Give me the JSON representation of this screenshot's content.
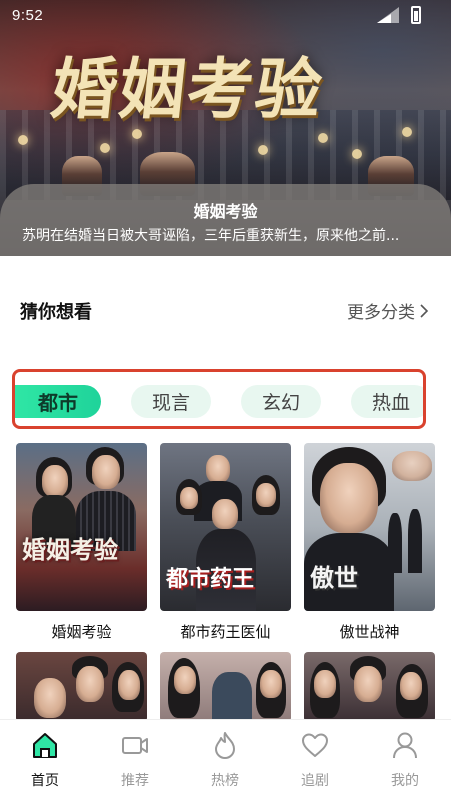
{
  "status_bar": {
    "time": "9:52"
  },
  "hero": {
    "title_art": "婚姻考验",
    "title": "婚姻考验",
    "description": "苏明在结婚当日被大哥诬陷，三年后重获新生，原来他之前..."
  },
  "section": {
    "title": "猜你想看",
    "more_label": "更多分类"
  },
  "categories": [
    {
      "label": "都市",
      "active": true
    },
    {
      "label": "现言",
      "active": false
    },
    {
      "label": "玄幻",
      "active": false
    },
    {
      "label": "热血",
      "active": false
    }
  ],
  "dramas": [
    {
      "title": "婚姻考验",
      "poster_text": "婚姻考验"
    },
    {
      "title": "都市药王医仙",
      "poster_text": "都市药王"
    },
    {
      "title": "傲世战神",
      "poster_text": "傲世"
    },
    {
      "title": "",
      "poster_text": ""
    },
    {
      "title": "",
      "poster_text": ""
    },
    {
      "title": "",
      "poster_text": ""
    }
  ],
  "bottom_nav": [
    {
      "label": "首页",
      "icon": "home-icon",
      "active": true
    },
    {
      "label": "推荐",
      "icon": "video-icon",
      "active": false
    },
    {
      "label": "热榜",
      "icon": "flame-icon",
      "active": false
    },
    {
      "label": "追剧",
      "icon": "heart-icon",
      "active": false
    },
    {
      "label": "我的",
      "icon": "user-icon",
      "active": false
    }
  ],
  "colors": {
    "accent": "#2fe6a5",
    "highlight_border": "#d9422e",
    "chip_bg": "#e8f7f0",
    "text_muted": "#999999"
  }
}
